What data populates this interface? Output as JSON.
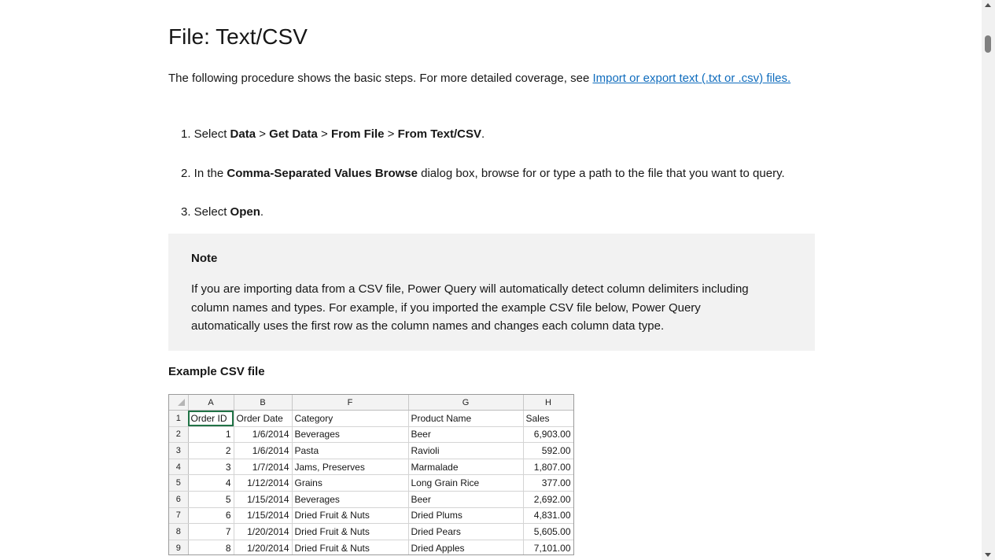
{
  "doc": {
    "title": "File: Text/CSV",
    "intro_text": "The following procedure shows the basic steps. For more detailed coverage, see ",
    "intro_link": "Import or export text (.txt or .csv) files.",
    "steps": [
      {
        "pre": "1. Select ",
        "parts": [
          "Data",
          " > ",
          "Get Data",
          " > ",
          "From File",
          " > ",
          "From Text/CSV",
          "."
        ]
      },
      {
        "pre": "2. In the ",
        "bold": "Comma-Separated Values Browse",
        "post": " dialog box, browse for or type a path to the file that you want to query."
      },
      {
        "pre": "3. Select ",
        "bold": "Open",
        "post": "."
      }
    ],
    "note": {
      "title": "Note",
      "body": "If you are importing data from a CSV file, Power Query will automatically detect column delimiters including column names and types. For example, if you imported the example CSV file below, Power Query automatically uses the first row as the column names and changes each column data type."
    },
    "example_title": "Example CSV file"
  },
  "sheet": {
    "col_headers": [
      "A",
      "B",
      "F",
      "G",
      "H"
    ],
    "rows": [
      {
        "n": "1",
        "a": "Order ID",
        "b": "Order Date",
        "f": "Category",
        "g": "Product Name",
        "h": "Sales"
      },
      {
        "n": "2",
        "a": "1",
        "b": "1/6/2014",
        "f": "Beverages",
        "g": "Beer",
        "h": "6,903.00"
      },
      {
        "n": "3",
        "a": "2",
        "b": "1/6/2014",
        "f": "Pasta",
        "g": "Ravioli",
        "h": "592.00"
      },
      {
        "n": "4",
        "a": "3",
        "b": "1/7/2014",
        "f": "Jams, Preserves",
        "g": "Marmalade",
        "h": "1,807.00"
      },
      {
        "n": "5",
        "a": "4",
        "b": "1/12/2014",
        "f": "Grains",
        "g": "Long Grain Rice",
        "h": "377.00"
      },
      {
        "n": "6",
        "a": "5",
        "b": "1/15/2014",
        "f": "Beverages",
        "g": "Beer",
        "h": "2,692.00"
      },
      {
        "n": "7",
        "a": "6",
        "b": "1/15/2014",
        "f": "Dried Fruit & Nuts",
        "g": "Dried Plums",
        "h": "4,831.00"
      },
      {
        "n": "8",
        "a": "7",
        "b": "1/20/2014",
        "f": "Dried Fruit & Nuts",
        "g": "Dried Pears",
        "h": "5,605.00"
      },
      {
        "n": "9",
        "a": "8",
        "b": "1/20/2014",
        "f": "Dried Fruit & Nuts",
        "g": "Dried Apples",
        "h": "7,101.00"
      }
    ]
  },
  "colors": {
    "link": "#0f6cbd",
    "note_bg": "#f2f2f2",
    "selection": "#217346"
  }
}
